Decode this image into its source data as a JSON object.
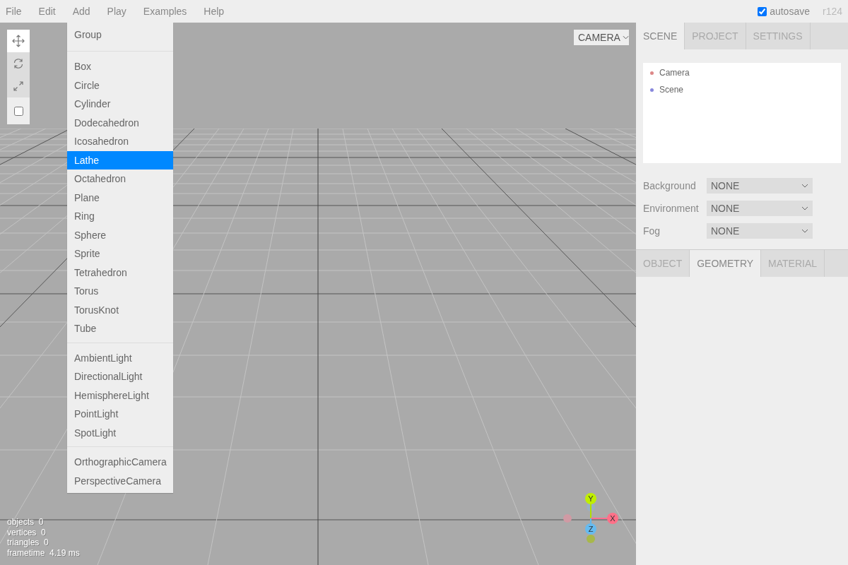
{
  "menubar": {
    "menus": [
      "File",
      "Edit",
      "Add",
      "Play",
      "Examples",
      "Help"
    ],
    "autosave": {
      "label": "autosave",
      "checked": true
    },
    "version": "r124"
  },
  "toolbar": {
    "tools": [
      {
        "kind": "move",
        "selected": true
      },
      {
        "kind": "rotate",
        "selected": false
      },
      {
        "kind": "scale",
        "selected": false
      }
    ],
    "local": {
      "checked": false
    }
  },
  "add_menu": {
    "groups": [
      [
        {
          "label": "Group",
          "selected": false
        }
      ],
      [
        {
          "label": "Box",
          "selected": false
        },
        {
          "label": "Circle",
          "selected": false
        },
        {
          "label": "Cylinder",
          "selected": false
        },
        {
          "label": "Dodecahedron",
          "selected": false
        },
        {
          "label": "Icosahedron",
          "selected": false
        },
        {
          "label": "Lathe",
          "selected": true
        },
        {
          "label": "Octahedron",
          "selected": false
        },
        {
          "label": "Plane",
          "selected": false
        },
        {
          "label": "Ring",
          "selected": false
        },
        {
          "label": "Sphere",
          "selected": false
        },
        {
          "label": "Sprite",
          "selected": false
        },
        {
          "label": "Tetrahedron",
          "selected": false
        },
        {
          "label": "Torus",
          "selected": false
        },
        {
          "label": "TorusKnot",
          "selected": false
        },
        {
          "label": "Tube",
          "selected": false
        }
      ],
      [
        {
          "label": "AmbientLight",
          "selected": false
        },
        {
          "label": "DirectionalLight",
          "selected": false
        },
        {
          "label": "HemisphereLight",
          "selected": false
        },
        {
          "label": "PointLight",
          "selected": false
        },
        {
          "label": "SpotLight",
          "selected": false
        }
      ],
      [
        {
          "label": "OrthographicCamera",
          "selected": false
        },
        {
          "label": "PerspectiveCamera",
          "selected": false
        }
      ]
    ]
  },
  "camera_select": {
    "value": "CAMERA"
  },
  "info": [
    {
      "label": "objects",
      "value": "0"
    },
    {
      "label": "vertices",
      "value": "0"
    },
    {
      "label": "triangles",
      "value": "0"
    },
    {
      "label": "frametime",
      "value": "4.19 ms"
    }
  ],
  "gizmo": {
    "axes": [
      "Y",
      "X",
      "Z"
    ]
  },
  "sidebar": {
    "tabs": [
      {
        "label": "SCENE",
        "selected": true
      },
      {
        "label": "PROJECT",
        "selected": false
      },
      {
        "label": "SETTINGS",
        "selected": false
      }
    ],
    "outliner": [
      {
        "label": "Camera",
        "color": "#dd8888"
      },
      {
        "label": "Scene",
        "color": "#8888dd"
      }
    ],
    "properties": [
      {
        "label": "Background",
        "value": "NONE"
      },
      {
        "label": "Environment",
        "value": "NONE"
      },
      {
        "label": "Fog",
        "value": "NONE"
      }
    ],
    "properties_tabs": [
      {
        "label": "OBJECT",
        "selected": false
      },
      {
        "label": "GEOMETRY",
        "selected": true
      },
      {
        "label": "MATERIAL",
        "selected": false
      }
    ]
  }
}
